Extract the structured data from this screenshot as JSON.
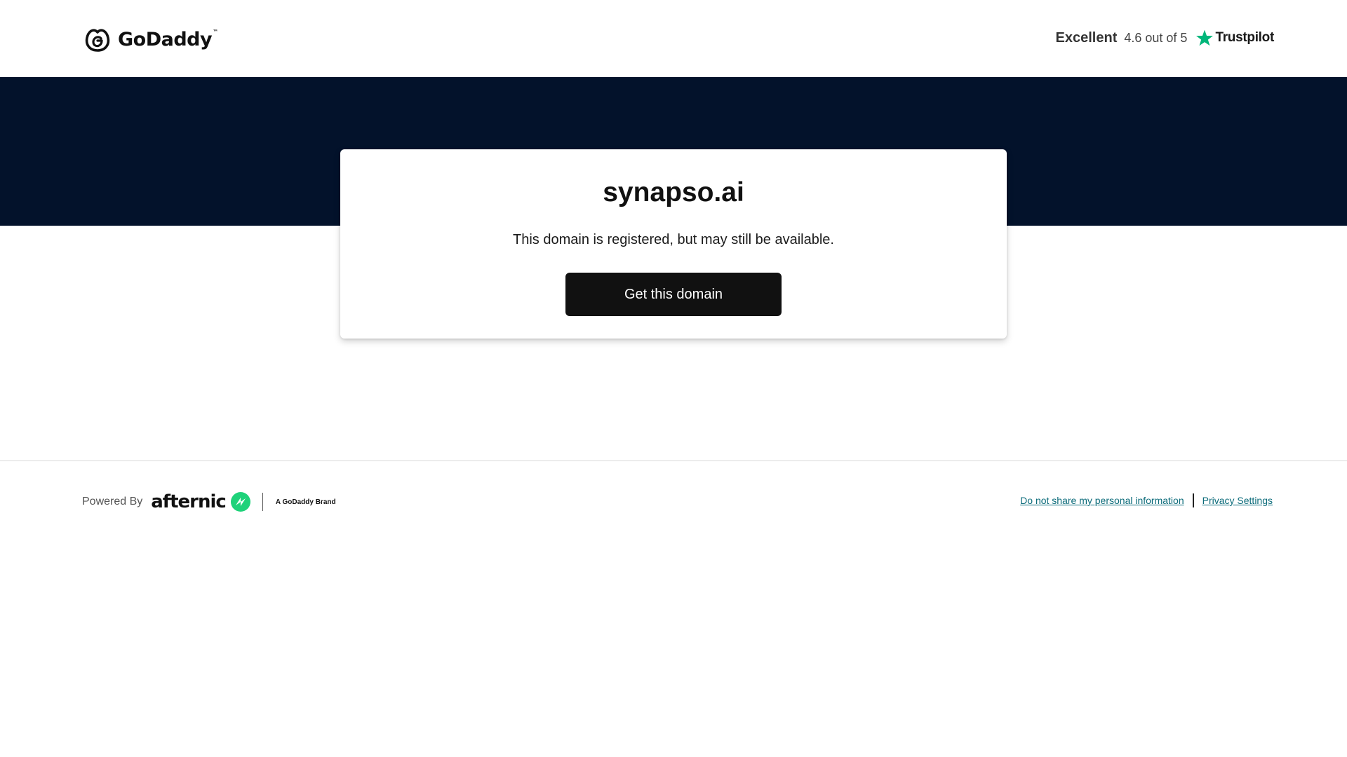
{
  "header": {
    "logo_text": "GoDaddy",
    "logo_tm": "™",
    "trust": {
      "excellent_label": "Excellent",
      "rating_text": "4.6 out of 5",
      "brand_name": "Trustpilot",
      "star_icon": "star-icon",
      "star_color": "#00b67a"
    }
  },
  "hero": {
    "background_color": "#03122b"
  },
  "card": {
    "domain_name": "synapso.ai",
    "status_text": "This domain is registered, but may still be available.",
    "cta_label": "Get this domain"
  },
  "footer": {
    "powered_by_label": "Powered By",
    "afternic_text": "afternic",
    "afternic_icon": "afternic-logo-icon",
    "godaddy_brand_text": "A GoDaddy Brand",
    "links": {
      "do_not_share": "Do not share my personal information",
      "privacy_settings": "Privacy Settings"
    },
    "link_color": "#0b6b7a"
  }
}
